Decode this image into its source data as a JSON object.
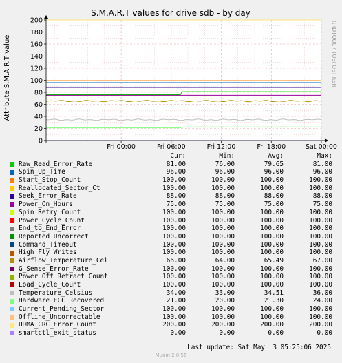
{
  "chart_data": {
    "type": "line",
    "title": "S.M.A.R.T values for drive sdb - by day",
    "ylabel": "Attribute S.M.A.R.T value",
    "xlabel": "",
    "ylim": [
      0,
      200
    ],
    "yticks": [
      0,
      20,
      40,
      60,
      80,
      100,
      120,
      140,
      160,
      180,
      200
    ],
    "xlim_hours": [
      -9,
      24
    ],
    "x_tick_labels": [
      "Fri 00:00",
      "Fri 06:00",
      "Fri 12:00",
      "Fri 18:00",
      "Sat 00:00"
    ],
    "x_tick_hours": [
      0,
      6,
      12,
      18,
      24
    ],
    "grid": true,
    "watermark": "RRDTOOL / TOBI OETIKER",
    "legend_headers": [
      "Cur:",
      "Min:",
      "Avg:",
      "Max:"
    ],
    "series": [
      {
        "name": "Raw_Read_Error_Rate",
        "color": "#00cc00",
        "cur": "81.00",
        "min": "76.00",
        "avg": "79.65",
        "max": "81.00",
        "shape": "step",
        "before": 76,
        "after": 81,
        "step_at": 7.1
      },
      {
        "name": "Spin_Up_Time",
        "color": "#0066b3",
        "cur": "96.00",
        "min": "96.00",
        "avg": "96.00",
        "max": "96.00",
        "shape": "flat",
        "value": 96
      },
      {
        "name": "Start_Stop_Count",
        "color": "#ff8000",
        "cur": "100.00",
        "min": "100.00",
        "avg": "100.00",
        "max": "100.00",
        "shape": "flat",
        "value": 100
      },
      {
        "name": "Reallocated_Sector_Ct",
        "color": "#ffcc00",
        "cur": "100.00",
        "min": "100.00",
        "avg": "100.00",
        "max": "100.00",
        "shape": "flat",
        "value": 100
      },
      {
        "name": "Seek_Error_Rate",
        "color": "#330099",
        "cur": "88.00",
        "min": "88.00",
        "avg": "88.00",
        "max": "88.00",
        "shape": "flat",
        "value": 88
      },
      {
        "name": "Power_On_Hours",
        "color": "#990099",
        "cur": "75.00",
        "min": "75.00",
        "avg": "75.00",
        "max": "75.00",
        "shape": "flat",
        "value": 75
      },
      {
        "name": "Spin_Retry_Count",
        "color": "#ccff00",
        "cur": "100.00",
        "min": "100.00",
        "avg": "100.00",
        "max": "100.00",
        "shape": "flat",
        "value": 100
      },
      {
        "name": "Power_Cycle_Count",
        "color": "#ff0000",
        "cur": "100.00",
        "min": "100.00",
        "avg": "100.00",
        "max": "100.00",
        "shape": "flat",
        "value": 100
      },
      {
        "name": "End_to_End_Error",
        "color": "#808080",
        "cur": "100.00",
        "min": "100.00",
        "avg": "100.00",
        "max": "100.00",
        "shape": "flat",
        "value": 100
      },
      {
        "name": "Reported_Uncorrect",
        "color": "#008f00",
        "cur": "100.00",
        "min": "100.00",
        "avg": "100.00",
        "max": "100.00",
        "shape": "flat",
        "value": 100
      },
      {
        "name": "Command_Timeout",
        "color": "#00487d",
        "cur": "100.00",
        "min": "100.00",
        "avg": "100.00",
        "max": "100.00",
        "shape": "flat",
        "value": 100
      },
      {
        "name": "High_Fly_Writes",
        "color": "#b35a00",
        "cur": "100.00",
        "min": "100.00",
        "avg": "100.00",
        "max": "100.00",
        "shape": "flat",
        "value": 100
      },
      {
        "name": "Airflow_Temperature_Cel",
        "color": "#b38f00",
        "cur": "66.00",
        "min": "64.00",
        "avg": "65.49",
        "max": "67.00",
        "shape": "noisy",
        "value": 65.5,
        "amp": 1.2
      },
      {
        "name": "G_Sense_Error_Rate",
        "color": "#6b006b",
        "cur": "100.00",
        "min": "100.00",
        "avg": "100.00",
        "max": "100.00",
        "shape": "flat",
        "value": 100
      },
      {
        "name": "Power_Off_Retract_Count",
        "color": "#8fb300",
        "cur": "100.00",
        "min": "100.00",
        "avg": "100.00",
        "max": "100.00",
        "shape": "flat",
        "value": 100
      },
      {
        "name": "Load_Cycle_Count",
        "color": "#b30000",
        "cur": "100.00",
        "min": "100.00",
        "avg": "100.00",
        "max": "100.00",
        "shape": "flat",
        "value": 100
      },
      {
        "name": "Temperature_Celsius",
        "color": "#bebebe",
        "cur": "34.00",
        "min": "33.00",
        "avg": "34.51",
        "max": "36.00",
        "shape": "noisy",
        "value": 34.5,
        "amp": 1.2
      },
      {
        "name": "Hardware_ECC_Recovered",
        "color": "#80ff80",
        "cur": "21.00",
        "min": "20.00",
        "avg": "21.30",
        "max": "24.00",
        "shape": "step",
        "before": 21,
        "after": 22.5,
        "step_at": 7.1
      },
      {
        "name": "Current_Pending_Sector",
        "color": "#80c9ff",
        "cur": "100.00",
        "min": "100.00",
        "avg": "100.00",
        "max": "100.00",
        "shape": "flat",
        "value": 100
      },
      {
        "name": "Offline_Uncorrectable",
        "color": "#ffc080",
        "cur": "100.00",
        "min": "100.00",
        "avg": "100.00",
        "max": "100.00",
        "shape": "flat",
        "value": 100
      },
      {
        "name": "UDMA_CRC_Error_Count",
        "color": "#ffe680",
        "cur": "200.00",
        "min": "200.00",
        "avg": "200.00",
        "max": "200.00",
        "shape": "flat",
        "value": 200
      },
      {
        "name": "smartctl_exit_status",
        "color": "#aa80ff",
        "cur": "0.00",
        "min": "0.00",
        "avg": "0.00",
        "max": "0.00",
        "shape": "flat",
        "value": 0
      }
    ]
  },
  "footer": {
    "last_update": "Last update: Sat May  3 05:25:06 2025",
    "version": "Munin 2.0.56"
  }
}
